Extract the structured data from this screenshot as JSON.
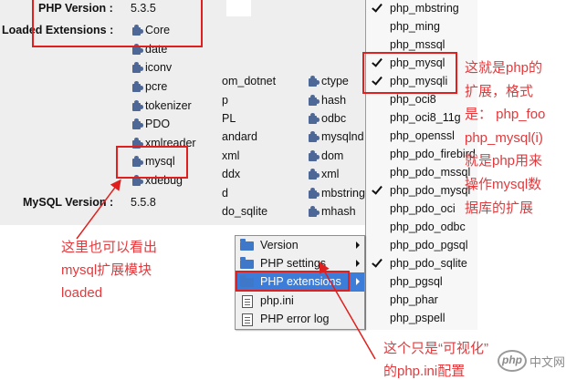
{
  "phpinfo": {
    "php_version_label": "PHP Version :",
    "php_version_value": "5.3.5",
    "loaded_extensions_label": "Loaded Extensions :",
    "mysql_version_label": "MySQL Version :",
    "mysql_version_value": "5.5.8",
    "extensions_col1": [
      "Core",
      "date",
      "iconv",
      "pcre",
      "tokenizer",
      "PDO",
      "xmlreader",
      "mysql",
      "xdebug"
    ],
    "extensions_col2": [
      "om_dotnet",
      "p",
      "PL",
      "andard",
      "xml",
      "ddx",
      "d",
      "do_sqlite"
    ],
    "extensions_col3": [
      "ctype",
      "hash",
      "odbc",
      "mysqlnd",
      "dom",
      "xml",
      "mbstring",
      "mhash"
    ],
    "extension_icon": "puzzle-icon"
  },
  "wamp_menu": {
    "items": [
      {
        "label": "Version",
        "icon": "folder-icon",
        "has_submenu": true,
        "highlighted": false
      },
      {
        "label": "PHP settings",
        "icon": "folder-icon",
        "has_submenu": true,
        "highlighted": false
      },
      {
        "label": "PHP extensions",
        "icon": "folder-icon",
        "has_submenu": true,
        "highlighted": true
      },
      {
        "label": "php.ini",
        "icon": "document-icon",
        "has_submenu": false,
        "highlighted": false
      },
      {
        "label": "PHP error log",
        "icon": "document-icon",
        "has_submenu": false,
        "highlighted": false
      }
    ]
  },
  "extensions_submenu": {
    "items": [
      {
        "label": "php_mbstring",
        "checked": true
      },
      {
        "label": "php_ming",
        "checked": false
      },
      {
        "label": "php_mssql",
        "checked": false
      },
      {
        "label": "php_mysql",
        "checked": true
      },
      {
        "label": "php_mysqli",
        "checked": true
      },
      {
        "label": "php_oci8",
        "checked": false
      },
      {
        "label": "php_oci8_11g",
        "checked": false
      },
      {
        "label": "php_openssl",
        "checked": false
      },
      {
        "label": "php_pdo_firebird",
        "checked": false
      },
      {
        "label": "php_pdo_mssql",
        "checked": false
      },
      {
        "label": "php_pdo_mysql",
        "checked": true
      },
      {
        "label": "php_pdo_oci",
        "checked": false
      },
      {
        "label": "php_pdo_odbc",
        "checked": false
      },
      {
        "label": "php_pdo_pgsql",
        "checked": false
      },
      {
        "label": "php_pdo_sqlite",
        "checked": true
      },
      {
        "label": "php_pgsql",
        "checked": false
      },
      {
        "label": "php_phar",
        "checked": false
      },
      {
        "label": "php_pspell",
        "checked": false
      }
    ]
  },
  "annotations": {
    "extension_format_note": [
      "这就是php的",
      "扩展，格式",
      "是： php_foo",
      "php_mysql(i)",
      "就是php用来",
      "操作mysql数",
      "据库的扩展"
    ],
    "loaded_note": [
      "这里也可以看出",
      "mysql扩展模块",
      "loaded"
    ],
    "visual_config_note": [
      "这个只是“可视化”",
      "的php.ini配置"
    ]
  },
  "watermark": {
    "logo_text": "php",
    "site_text": "中文网"
  },
  "colors": {
    "annotation_red": "#e4393c",
    "highlight_box_red": "#e0201e",
    "panel_gray": "#eeeeee",
    "menu_highlight": "#3b7dd8",
    "extension_icon_blue": "#4d6796"
  }
}
